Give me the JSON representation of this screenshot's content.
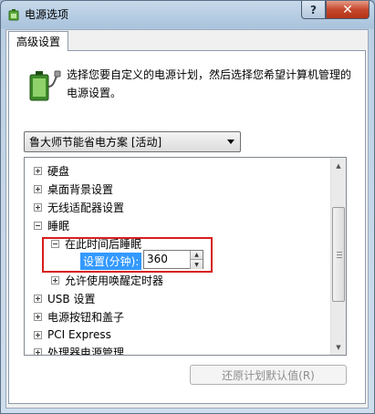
{
  "window": {
    "title": "电源选项",
    "help_label": "?",
    "close_label": "✕"
  },
  "tab": {
    "label": "高级设置"
  },
  "description": "选择您要自定义的电源计划，然后选择您希望计算机管理的电源设置。",
  "plan_select": {
    "value": "鲁大师节能省电方案 [活动]"
  },
  "tree": {
    "items": [
      {
        "label": "硬盘",
        "expander": "plus"
      },
      {
        "label": "桌面背景设置",
        "expander": "plus"
      },
      {
        "label": "无线适配器设置",
        "expander": "plus"
      },
      {
        "label": "睡眠",
        "expander": "minus"
      },
      {
        "label": "在此时间后睡眠",
        "expander": "minus"
      },
      {
        "label": "允许使用唤醒定时器",
        "expander": "plus"
      },
      {
        "label": "USB 设置",
        "expander": "plus"
      },
      {
        "label": "电源按钮和盖子",
        "expander": "plus"
      },
      {
        "label": "PCI Express",
        "expander": "plus"
      },
      {
        "label": "处理器电源管理",
        "expander": "plus"
      }
    ],
    "setting_label": "设置(分钟):",
    "setting_value": "360"
  },
  "restore_button": {
    "label": "还原计划默认值(R)"
  },
  "icons": {
    "window": "power-options-icon",
    "battery": "battery-plug-icon"
  }
}
